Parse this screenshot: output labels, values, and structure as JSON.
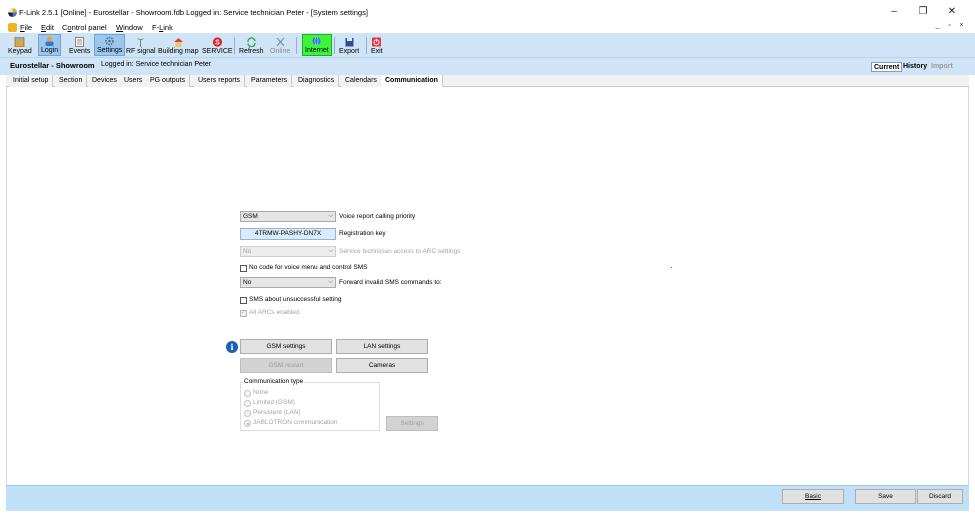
{
  "window": {
    "title": "F-Link 2.5.1 [Online] - Eurostellar - Showroom.fdb Logged in: Service technician Peter - [System settings]",
    "minimize_label": "–",
    "restore_label": "❐",
    "close_label": "✕",
    "mdi_minimize": "_",
    "mdi_restore": "▫",
    "mdi_close": "×"
  },
  "menu": {
    "file": {
      "u": "F",
      "rest": "ile"
    },
    "edit": {
      "u": "E",
      "rest": "dit"
    },
    "control_panel": {
      "pre": "C",
      "u": "o",
      "rest": "ntrol panel"
    },
    "window": {
      "u": "W",
      "rest": "indow"
    },
    "flink": {
      "pre": "F-",
      "u": "L",
      "rest": "ink"
    }
  },
  "toolbar": {
    "keypad": "Keypad",
    "login": "Login",
    "events": "Events",
    "settings": "Settings",
    "rf_signal": "RF signal",
    "building_map": "Building map",
    "service": "SERVICE",
    "refresh": "Refresh",
    "online": "Online",
    "internet": "Internet",
    "export": "Export",
    "exit": "Exit"
  },
  "infobar": {
    "site": "Eurostellar - Showroom",
    "logged_in": "Logged in: Service technician Peter",
    "view_tabs": [
      "Current",
      "History",
      "Import"
    ]
  },
  "tabs": [
    "Initial setup",
    "Section",
    "Devices",
    "Users",
    "PG outputs",
    "Users reports",
    "Parameters",
    "Diagnostics",
    "Calendars",
    "Communication"
  ],
  "form": {
    "voice_priority_value": "GSM",
    "voice_priority_label": "Voice report calling priority",
    "registration_key_value": "4TRMW-PASHY-DN7X",
    "registration_key_label": "Registration key",
    "arc_access_value": "No",
    "arc_access_label": "Service technician access to ARC settings",
    "no_code_label": "No code for voice menu and control SMS",
    "forward_sms_value": "No",
    "forward_sms_label": "Forward invalid SMS commands to:",
    "sms_unsuccessful_label": "SMS about unsuccessful setting",
    "all_arcs_label": "All ARCs enabled",
    "gsm_settings": "GSM settings",
    "lan_settings": "LAN settings",
    "gsm_restart": "GSM restart",
    "cameras": "Cameras",
    "comm_type_legend": "Communication type",
    "comm_options": [
      "None",
      "Limited (GSM)",
      "Persistent (LAN)",
      "JABLOTRON communication"
    ],
    "comm_settings": "Settings"
  },
  "bottom": {
    "basic": "Basic",
    "save": "Save",
    "discard": "Discard"
  }
}
